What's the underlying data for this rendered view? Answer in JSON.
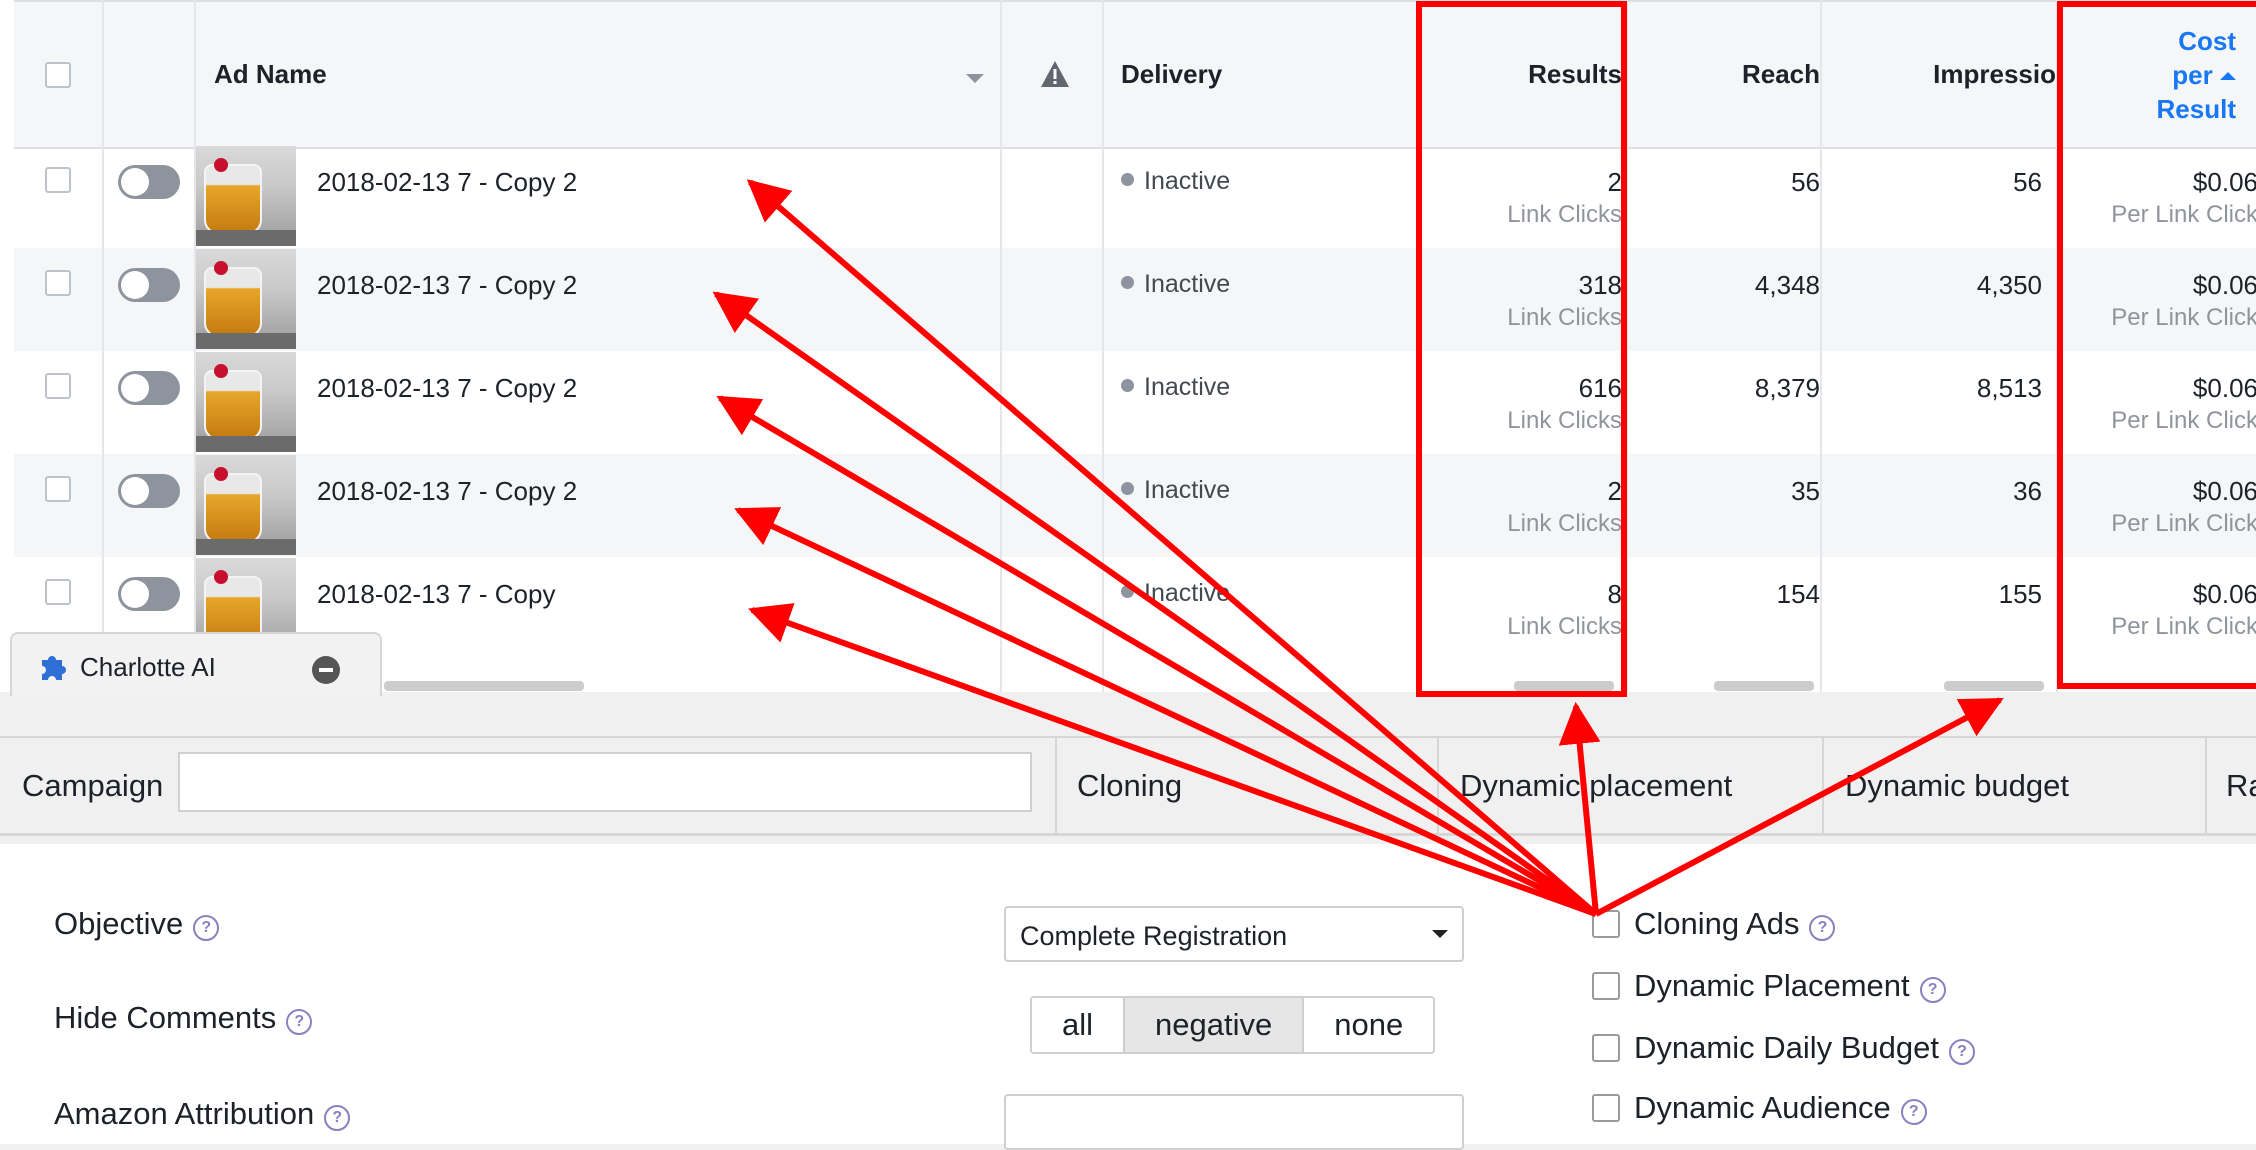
{
  "table": {
    "headers": {
      "ad_name": "Ad Name",
      "delivery": "Delivery",
      "results": "Results",
      "reach": "Reach",
      "impressions": "Impressio",
      "cost_line1": "Cost",
      "cost_line2": "per",
      "cost_line3": "Result"
    },
    "rows": [
      {
        "name": "2018-02-13 7 - Copy 2",
        "delivery": "Inactive",
        "results": "2",
        "results_unit": "Link Clicks",
        "reach": "56",
        "impressions": "56",
        "cost": "$0.06",
        "cost_unit": "Per Link Click"
      },
      {
        "name": "2018-02-13 7 - Copy 2",
        "delivery": "Inactive",
        "results": "318",
        "results_unit": "Link Clicks",
        "reach": "4,348",
        "impressions": "4,350",
        "cost": "$0.06",
        "cost_unit": "Per Link Click"
      },
      {
        "name": "2018-02-13 7 - Copy 2",
        "delivery": "Inactive",
        "results": "616",
        "results_unit": "Link Clicks",
        "reach": "8,379",
        "impressions": "8,513",
        "cost": "$0.06",
        "cost_unit": "Per Link Click"
      },
      {
        "name": "2018-02-13 7 - Copy 2",
        "delivery": "Inactive",
        "results": "2",
        "results_unit": "Link Clicks",
        "reach": "35",
        "impressions": "36",
        "cost": "$0.06",
        "cost_unit": "Per Link Click"
      },
      {
        "name": "2018-02-13 7 - Copy",
        "delivery": "Inactive",
        "results": "8",
        "results_unit": "Link Clicks",
        "reach": "154",
        "impressions": "155",
        "cost": "$0.06",
        "cost_unit": "Per Link Click"
      }
    ]
  },
  "panel": {
    "title": "Charlotte AI",
    "tabs": {
      "campaign": "Campaign",
      "cloning": "Cloning",
      "dynamic_placement": "Dynamic placement",
      "dynamic_budget": "Dynamic budget",
      "cut_off": "Ra"
    },
    "objective_label": "Objective",
    "objective_value": "Complete Registration",
    "hide_comments_label": "Hide Comments",
    "hide_comments_options": [
      "all",
      "negative",
      "none"
    ],
    "hide_comments_selected": "negative",
    "amazon_label": "Amazon Attribution",
    "checkboxes": [
      "Cloning Ads",
      "Dynamic Placement",
      "Dynamic Daily Budget",
      "Dynamic Audience"
    ],
    "help_glyph": "?"
  },
  "colors": {
    "annotation": "#ff0000",
    "sorted_header": "#1877f2"
  }
}
